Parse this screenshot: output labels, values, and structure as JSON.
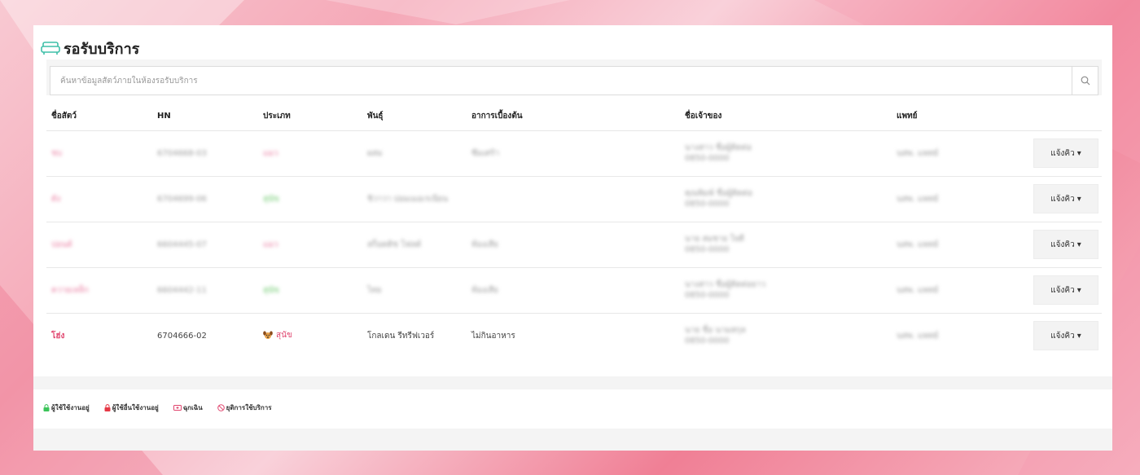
{
  "header": {
    "title": "รอรับบริการ",
    "icon": "sofa-icon"
  },
  "search": {
    "placeholder": "ค้นหาข้อมูลสัตว์ภายในห้องรอรับบริการ"
  },
  "table": {
    "columns": [
      "ชื่อสัตว์",
      "HN",
      "ประเภท",
      "พันธุ์",
      "อาการเบื้องต้น",
      "ชื่อเจ้าของ",
      "แพทย์"
    ],
    "rows": [
      {
        "name": "ชบ",
        "hn": "6704668-03",
        "type": "แมว",
        "breed": "ผสม",
        "symptom": "ซึมเศร้า",
        "owner1": "นางสาว ชื่อผู้ติดต่อ",
        "owner2": "0850-0000",
        "doctor": "นสพ. แพทย์",
        "queue": "แจ้งคิว"
      },
      {
        "name": "ดัง",
        "hn": "6704699-06",
        "type": "สุนัข",
        "breed": "ชิวาวา ปอมเมอเรเนียน",
        "symptom": "",
        "owner1": "คุณพิมพ์ ชื่อผู้ติดต่อ",
        "owner2": "0850-0000",
        "doctor": "นสพ. แพทย์",
        "queue": "แจ้งคิว"
      },
      {
        "name": "ปอนด์",
        "hn": "6604445-07",
        "type": "แมว",
        "breed": "สก็อตติช โฟลด์",
        "symptom": "ท้องเสีย",
        "owner1": "นาย สมชาย ใจดี",
        "owner2": "0850-0000",
        "doctor": "นสพ. แพทย์",
        "queue": "แจ้งคิว"
      },
      {
        "name": "ควายเหล็ก",
        "hn": "6604442-11",
        "type": "สุนัข",
        "breed": "ไทย",
        "symptom": "ท้องเสีย",
        "owner1": "นางสาว ชื่อผู้ติดต่อยาว",
        "owner2": "0850-0000",
        "doctor": "นสพ. แพทย์",
        "queue": "แจ้งคิว"
      },
      {
        "name": "โฮ่ง",
        "hn": "6704666-02",
        "type": "สุนัข",
        "breed": "โกลเดน รีทรีฟเวอร์",
        "symptom": "ไม่กินอาหาร",
        "owner1": "นาย ชื่อ นามสกุล",
        "owner2": "0850-0000",
        "doctor": "นสพ. แพทย์",
        "queue": "แจ้งคิว",
        "clear": true
      }
    ]
  },
  "legend": [
    {
      "label": "ผู้ใช้ใช้งานอยู่",
      "icon": "lock-icon",
      "color": "#3cc45a"
    },
    {
      "label": "ผู้ใช้อื่นใช้งานอยู่",
      "icon": "lock-icon",
      "color": "#e63946"
    },
    {
      "label": "ฉุกเฉิน",
      "icon": "ambulance-icon",
      "color": "#e0456e"
    },
    {
      "label": "ยุติการใช้บริการ",
      "icon": "cancel-icon",
      "color": "#e0456e"
    }
  ],
  "colors": {
    "accent": "#e0456e",
    "icon_teal": "#3fbfa8"
  }
}
